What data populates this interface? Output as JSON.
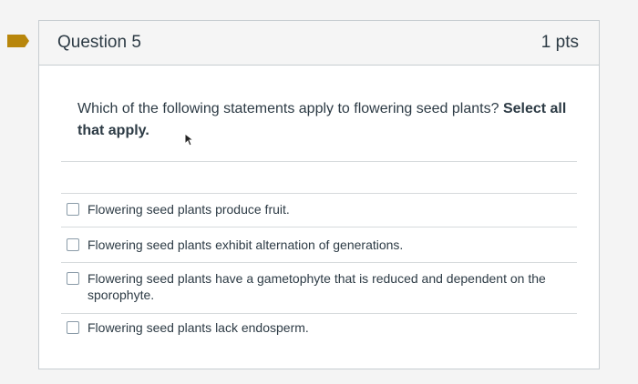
{
  "question": {
    "title": "Question 5",
    "points": "1 pts",
    "text_plain": "Which of the following statements apply to flowering seed plants?",
    "text_bold": "Select all that apply."
  },
  "answers": [
    {
      "label": "Flowering seed plants produce fruit.",
      "checked": false
    },
    {
      "label": "Flowering seed plants exhibit alternation of generations.",
      "checked": false
    },
    {
      "label": "Flowering seed plants have a gametophyte that is reduced and dependent on the sporophyte.",
      "checked": false
    },
    {
      "label": "Flowering seed plants lack endosperm.",
      "checked": false
    }
  ],
  "colors": {
    "bookmark": "#b8860b",
    "header_bg": "#f5f5f5",
    "text": "#2d3b45",
    "border": "#c7cdd1"
  }
}
